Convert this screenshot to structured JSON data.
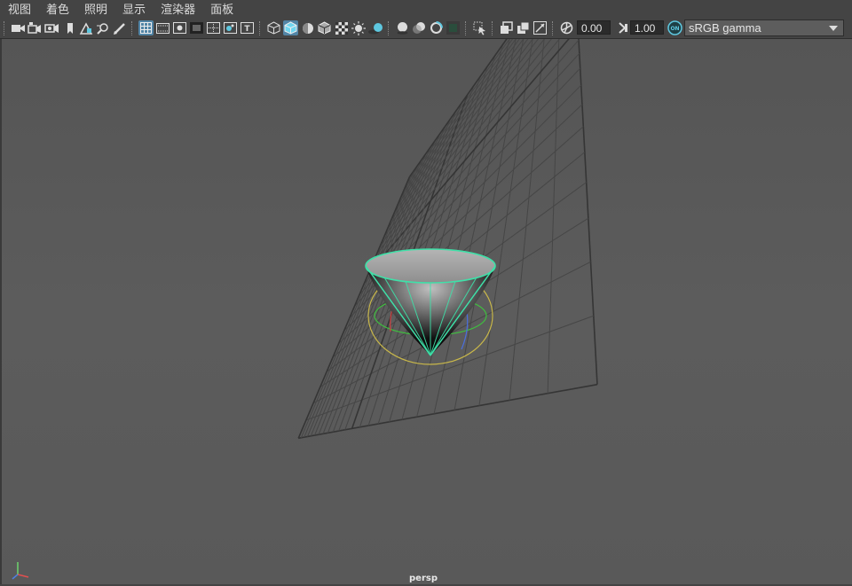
{
  "menu": {
    "items": [
      "视图",
      "着色",
      "照明",
      "显示",
      "渲染器",
      "面板"
    ]
  },
  "toolbar": {
    "exposure_value": "0.00",
    "gamma_value": "1.00",
    "colorspace_selected": "sRGB gamma",
    "icons": [
      "select-camera-icon",
      "camera-attributes-icon",
      "bookmark-camera-icon",
      "camera-bookmark-icon",
      "image-plane-icon",
      "2d-pan-zoom-icon",
      "grease-pencil-icon",
      "grid-icon",
      "film-gate-icon",
      "resolution-gate-icon",
      "gate-mask-icon",
      "field-chart-icon",
      "safe-action-icon",
      "safe-title-icon",
      "wireframe-icon",
      "smooth-shade-icon",
      "default-material-icon",
      "wireframe-on-shaded-icon",
      "textured-icon",
      "use-all-lights-icon",
      "shadows-icon",
      "screen-space-ao-icon",
      "motion-blur-icon",
      "multisample-aa-icon",
      "depth-of-field-icon",
      "isolate-select-icon",
      "xray-icon",
      "xray-active-components-icon",
      "xray-joints-icon",
      "exposure-icon",
      "gamma-icon",
      "color-management-icon"
    ]
  },
  "viewport": {
    "camera_label": "persp",
    "accent_color": "#3fe0a8",
    "background_color": "#5a5a5a"
  }
}
